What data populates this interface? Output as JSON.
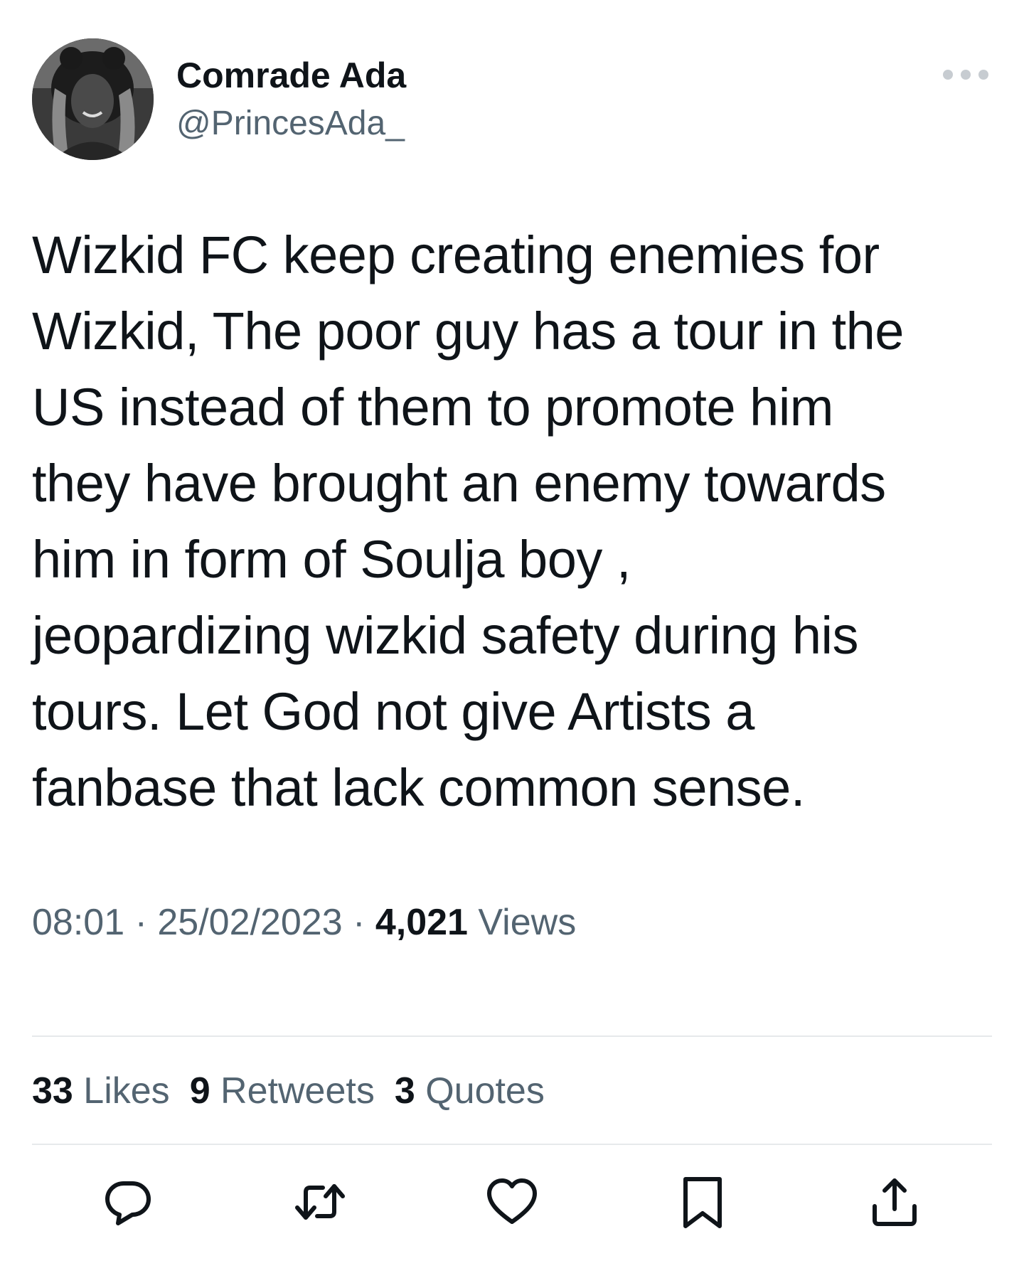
{
  "author": {
    "display_name": "Comrade Ada",
    "handle": "@PrincesAda_",
    "avatar_icon": "profile-photo"
  },
  "tweet": {
    "text_lines": [
      "Wizkid FC keep creating enemies for",
      "Wizkid, The poor guy has a tour in the",
      "US instead of them to promote him",
      "they have brought an enemy towards",
      "him in form of Soulja boy ,",
      "jeopardizing wizkid safety during his",
      "tours. Let God not give Artists a",
      "fanbase that lack common sense."
    ]
  },
  "meta": {
    "time": "08:01",
    "separator": " · ",
    "date": "25/02/2023",
    "views_count": "4,021",
    "views_label": " Views"
  },
  "stats": {
    "likes_count": "33",
    "likes_label": " Likes",
    "retweets_count": "9",
    "retweets_label": " Retweets",
    "quotes_count": "3",
    "quotes_label": " Quotes"
  },
  "actions": [
    "reply-icon",
    "retweet-icon",
    "like-icon",
    "bookmark-icon",
    "share-icon"
  ],
  "colors": {
    "text_primary": "#0f1419",
    "text_secondary": "#536471",
    "divider": "#e6e9eb"
  }
}
